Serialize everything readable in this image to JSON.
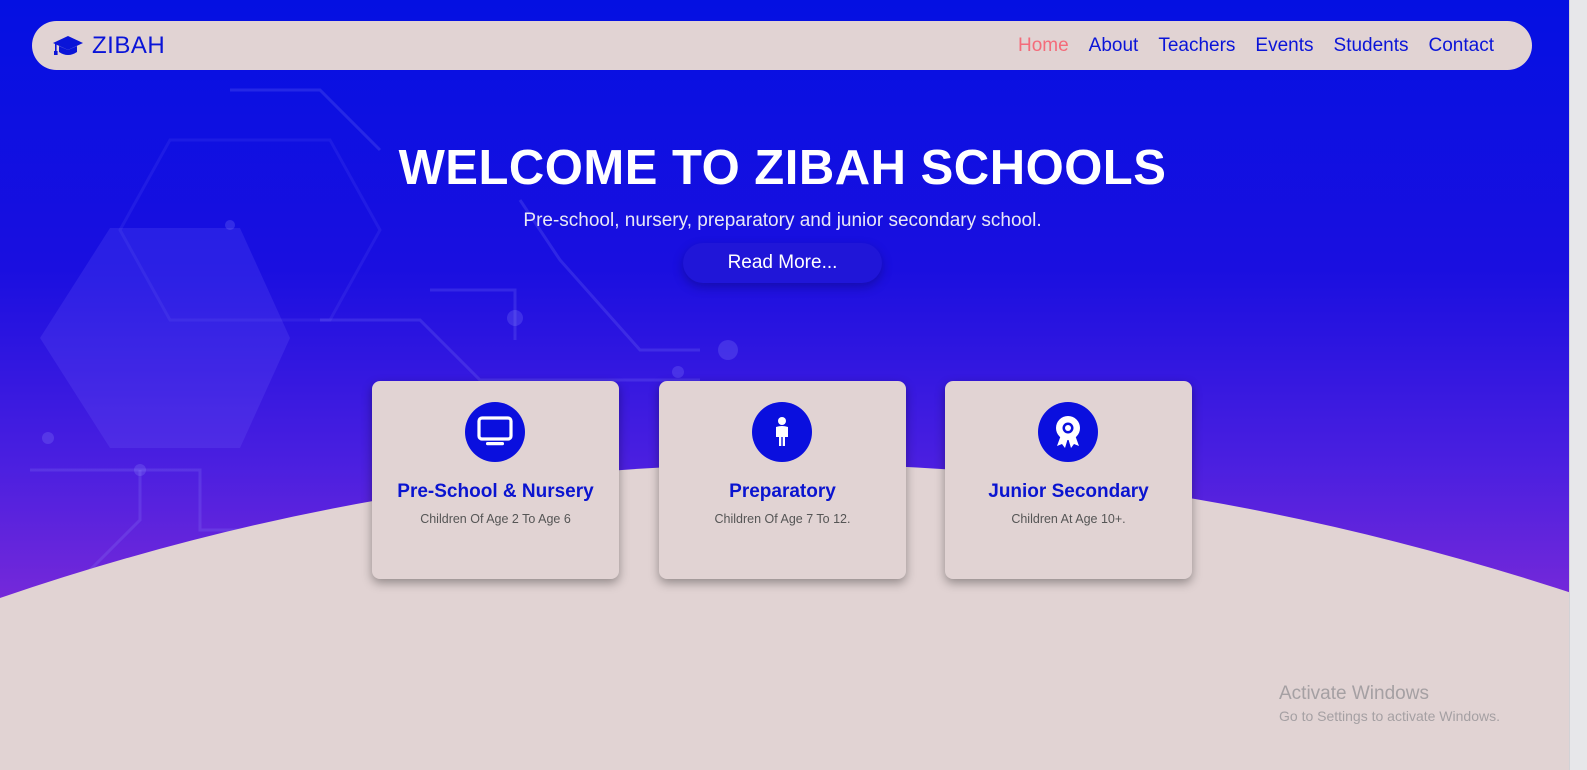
{
  "navbar": {
    "brand_text": "ZIBAH",
    "brand_icon": "graduation-cap-icon",
    "links": [
      {
        "label": "Home",
        "active": true
      },
      {
        "label": "About",
        "active": false
      },
      {
        "label": "Teachers",
        "active": false
      },
      {
        "label": "Events",
        "active": false
      },
      {
        "label": "Students",
        "active": false
      },
      {
        "label": "Contact",
        "active": false
      }
    ]
  },
  "hero": {
    "title": "WELCOME TO ZIBAH SCHOOLS",
    "subtitle": "Pre-school, nursery, preparatory and junior secondary school.",
    "button_label": "Read More..."
  },
  "cards": [
    {
      "icon": "monitor-icon",
      "title": "Pre-School & Nursery",
      "description": "Children Of Age 2 To Age 6"
    },
    {
      "icon": "child-icon",
      "title": "Preparatory",
      "description": "Children Of Age 7 To 12."
    },
    {
      "icon": "award-icon",
      "title": "Junior Secondary",
      "description": "Children At Age 10+."
    }
  ],
  "watermark": {
    "title": "Activate Windows",
    "subtitle": "Go to Settings to activate Windows."
  },
  "colors": {
    "primary": "#0a14d8",
    "active_link": "#f46b7a",
    "surface": "#e1d3d3",
    "gradient_top": "#0410e2",
    "gradient_bottom": "#7a2ad8"
  }
}
